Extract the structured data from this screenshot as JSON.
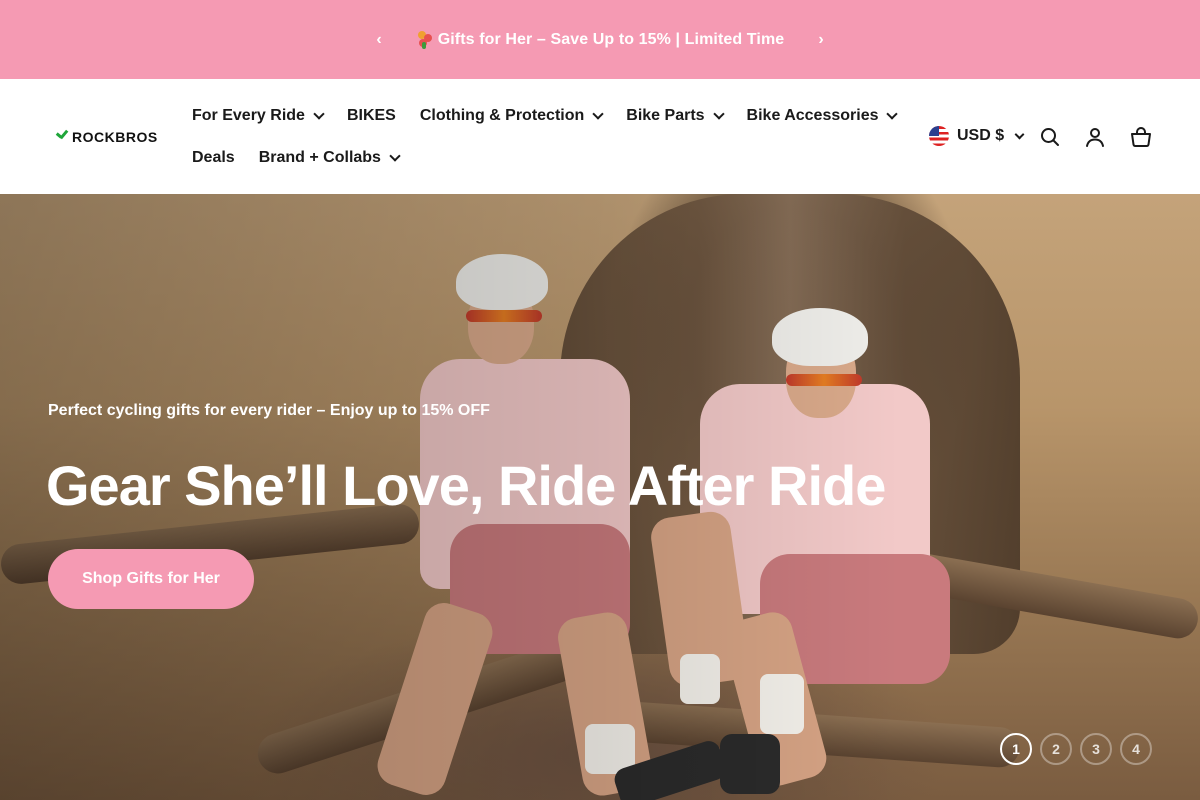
{
  "announcement": {
    "message": "Gifts for Her – Save Up to 15% | Limited Time",
    "prev_icon": "chevron-left-icon",
    "next_icon": "chevron-right-icon",
    "background": "#f59ab3"
  },
  "header": {
    "logo_text": "ROCKBROS",
    "logo_accent": "#1fa63a",
    "nav_row1": [
      {
        "label": "For Every Ride",
        "has_dropdown": true
      },
      {
        "label": "BIKES",
        "has_dropdown": false
      },
      {
        "label": "Clothing & Protection",
        "has_dropdown": true
      },
      {
        "label": "Bike Parts",
        "has_dropdown": true
      },
      {
        "label": "Bike Accessories",
        "has_dropdown": true
      }
    ],
    "nav_row2": [
      {
        "label": "Deals",
        "has_dropdown": false
      },
      {
        "label": "Brand + Collabs",
        "has_dropdown": true
      }
    ],
    "currency": "USD $",
    "icons": [
      "search-icon",
      "account-icon",
      "cart-icon"
    ]
  },
  "hero": {
    "subtitle": "Perfect cycling gifts for every rider – Enjoy up to 15% OFF",
    "title": "Gear She’ll Love, Ride After Ride",
    "cta_label": "Shop Gifts for Her",
    "slides": [
      "1",
      "2",
      "3",
      "4"
    ],
    "active_slide": 1,
    "accent": "#f59ab3"
  }
}
